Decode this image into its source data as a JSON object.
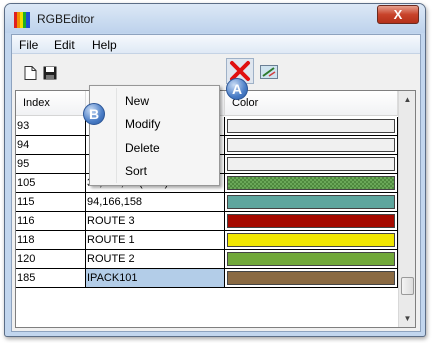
{
  "window": {
    "title": "RGBEditor",
    "close_label": "X"
  },
  "menu": {
    "items": [
      "File",
      "Edit",
      "Help"
    ]
  },
  "toolbar": {
    "icons": [
      "new-doc-icon",
      "save-icon",
      "delete-x-icon",
      "edit-color-icon"
    ]
  },
  "grid": {
    "columns": [
      "Index",
      "",
      "Color"
    ],
    "rows": [
      {
        "index": "93",
        "name": "",
        "color": "#f0f0f0"
      },
      {
        "index": "94",
        "name": "",
        "color": "#f0f0f0"
      },
      {
        "index": "95",
        "name": "",
        "color": "#f0f0f0"
      },
      {
        "index": "105",
        "name": "34,135,16 (59%)",
        "color": "#6aa858",
        "pattern": "checker"
      },
      {
        "index": "115",
        "name": "94,166,158",
        "color": "#5ea69e"
      },
      {
        "index": "116",
        "name": "ROUTE 3",
        "color": "#a50a00"
      },
      {
        "index": "118",
        "name": "ROUTE 1",
        "color": "#f0e600"
      },
      {
        "index": "120",
        "name": "ROUTE 2",
        "color": "#71a83a"
      },
      {
        "index": "185",
        "name": "IPACK101",
        "color": "#8a6a43",
        "selected": true
      }
    ]
  },
  "context_menu": {
    "items": [
      "New",
      "Modify",
      "Delete",
      "Sort"
    ]
  },
  "callouts": {
    "a": "A",
    "b": "B"
  }
}
